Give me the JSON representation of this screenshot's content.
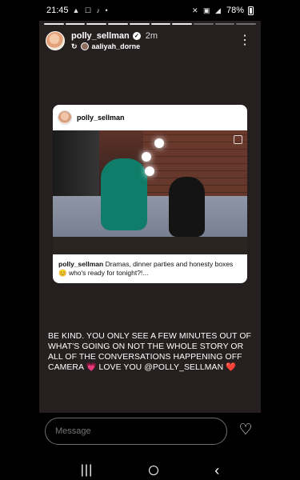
{
  "status_bar": {
    "time": "21:45",
    "left_icons": "▲ ☐ ♪ •",
    "battery": "78%",
    "right_icons": "✕ ▣ ◢"
  },
  "story": {
    "username": "polly_sellman",
    "time_ago": "2m",
    "reshared_from": "aaliyah_dorne"
  },
  "shared_post": {
    "username": "polly_sellman",
    "caption_user": "polly_sellman",
    "caption_text": "Dramas, dinner parties and honesty boxes 😊 who's ready for tonight?!..."
  },
  "story_text": "BE KIND. YOU ONLY SEE A FEW MINUTES OUT OF WHAT'S GOING ON NOT THE WHOLE STORY OR ALL OF THE CONVERSATIONS HAPPENING OFF CAMERA 💗 LOVE YOU @POLLY_SELLMAN ❤️",
  "reply_bar": {
    "message_placeholder": "Message"
  },
  "icons": {
    "verified": "verified-icon",
    "repost": "repost-icon",
    "more": "more-icon",
    "heart": "heart-icon",
    "copy": "copy-icon"
  }
}
